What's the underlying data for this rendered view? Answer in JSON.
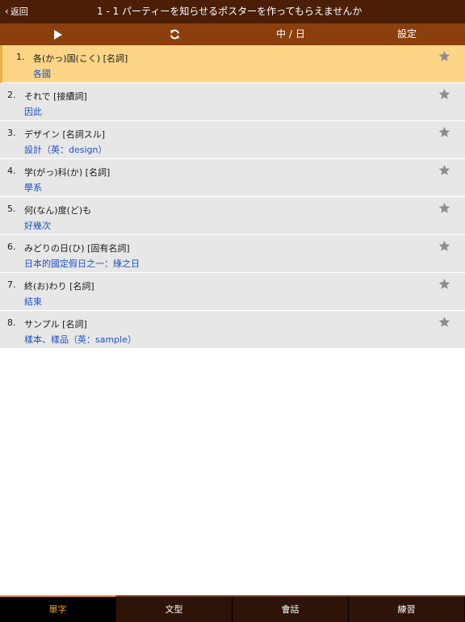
{
  "header": {
    "back_label": "返回",
    "title": "1 - 1 パーティーを知らせるポスターを作ってもらえませんか"
  },
  "toolbar": {
    "play_icon": "play-icon",
    "repeat_icon": "repeat-icon",
    "language_label": "中 / 日",
    "settings_label": "設定"
  },
  "words": [
    {
      "index": "1.",
      "term": "各(かっ)国(こく)  [名詞]",
      "meaning": "各國",
      "selected": true
    },
    {
      "index": "2.",
      "term": "それで  [接續詞]",
      "meaning": "因此",
      "selected": false
    },
    {
      "index": "3.",
      "term": "デザイン  [名詞スル]",
      "meaning": "設計（英：design）",
      "selected": false
    },
    {
      "index": "4.",
      "term": "学(がっ)科(か)  [名詞]",
      "meaning": "學系",
      "selected": false
    },
    {
      "index": "5.",
      "term": "何(なん)度(ど)も",
      "meaning": "好幾次",
      "selected": false
    },
    {
      "index": "6.",
      "term": "みどりの日(ひ)  [固有名詞]",
      "meaning": "日本的國定假日之一：綠之日",
      "selected": false
    },
    {
      "index": "7.",
      "term": "終(お)わり  [名詞]",
      "meaning": "結束",
      "selected": false
    },
    {
      "index": "8.",
      "term": "サンプル  [名詞]",
      "meaning": "樣本、樣品（英：sample）",
      "selected": false
    }
  ],
  "tabs": [
    {
      "label": "單字",
      "active": true
    },
    {
      "label": "文型",
      "active": false
    },
    {
      "label": "會話",
      "active": false
    },
    {
      "label": "練習",
      "active": false
    }
  ],
  "colors": {
    "nav_bg": "#4a1f06",
    "toolbar_bg": "#8a3f0c",
    "selected_row": "#fdd587",
    "row_bg": "#e7e7e7",
    "meaning_text": "#1b4fc9",
    "tab_active_text": "#f2a23c"
  }
}
